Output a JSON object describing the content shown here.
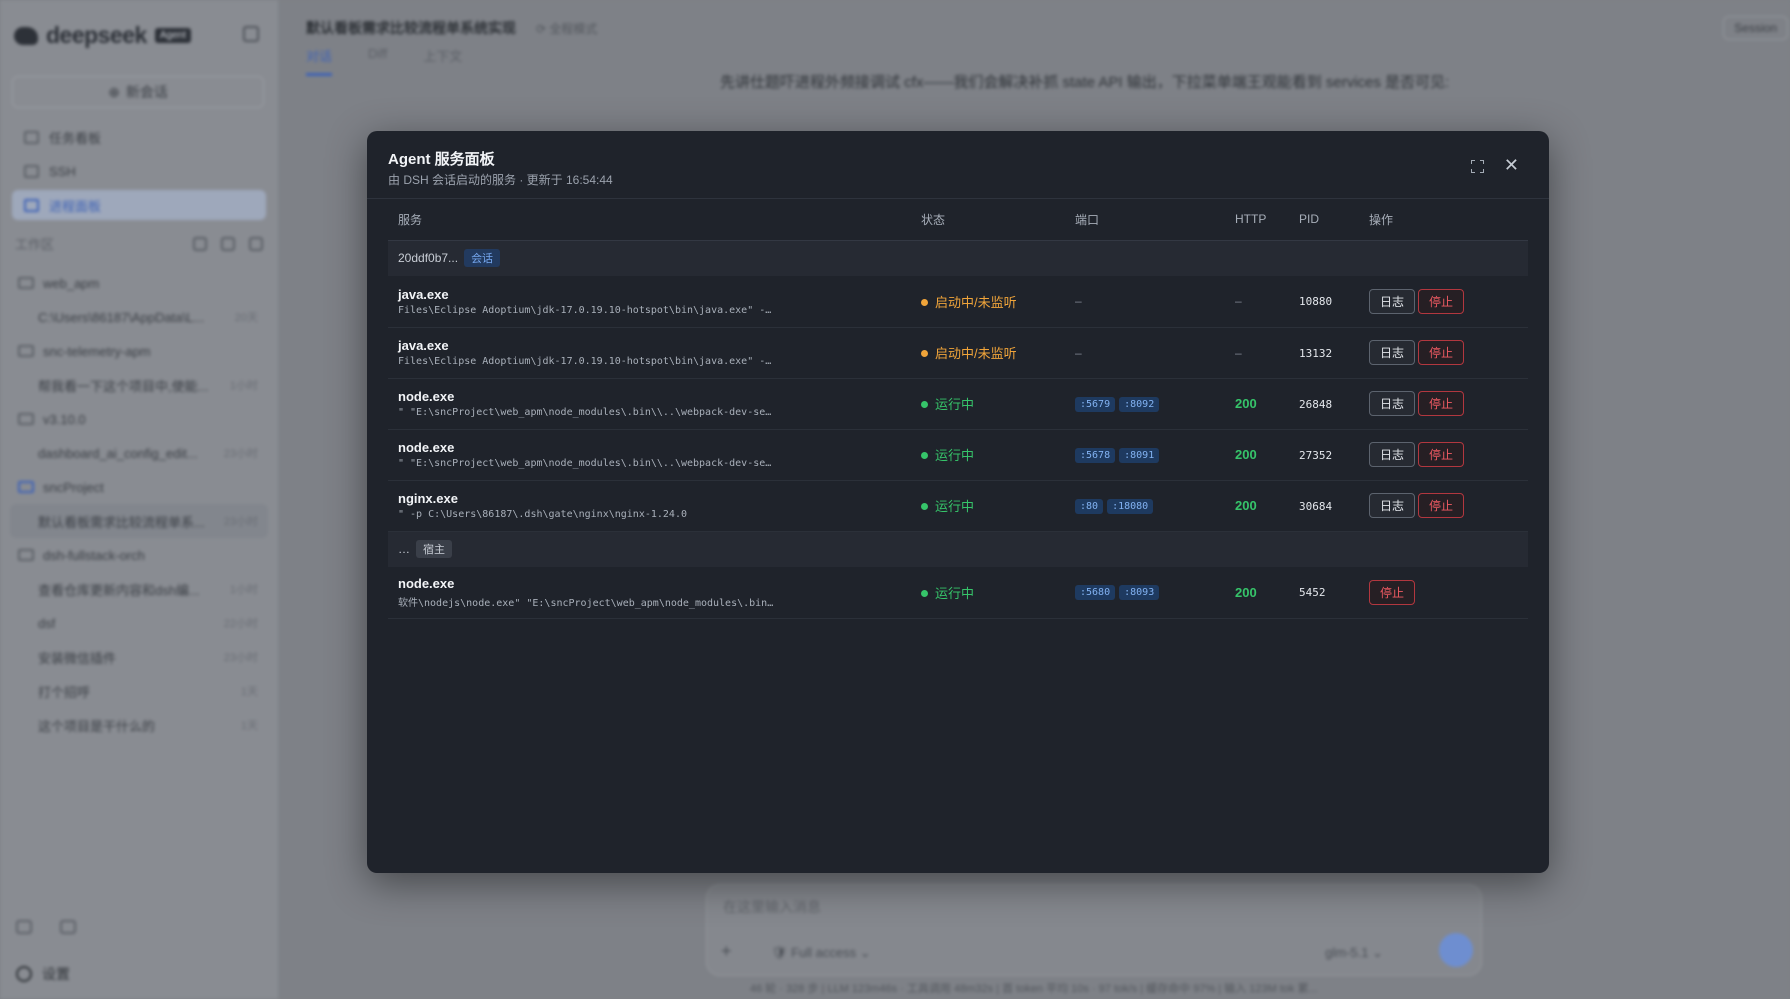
{
  "app": {
    "brand": "deepseek",
    "brand_badge": "Agent",
    "new_chat": "新会话",
    "nav": [
      "任务看板",
      "SSH",
      "进程面板"
    ],
    "workspace_label": "工作区",
    "tree": [
      {
        "type": "folder",
        "label": "web_apm"
      },
      {
        "type": "child",
        "label": "C:\\Users\\86187\\AppData\\L...",
        "date": "20天"
      },
      {
        "type": "folder",
        "label": "snc-telemetry-apm"
      },
      {
        "type": "child",
        "label": "帮我看一下这个项目中,使能...",
        "date": "1小时"
      },
      {
        "type": "folder",
        "label": "v3.10.0"
      },
      {
        "type": "child",
        "label": "dashboard_ai_config_edit...",
        "date": "23小时"
      },
      {
        "type": "folder",
        "label": "sncProject",
        "blue": true
      },
      {
        "type": "child",
        "label": "默认看板需求比较流程单系...",
        "date": "23小时",
        "selected": true
      },
      {
        "type": "folder",
        "label": "dsh-fullstack-orch"
      },
      {
        "type": "child",
        "label": "查看仓库更新内容和dsh编...",
        "date": "1小时"
      },
      {
        "type": "child",
        "label": "dsf",
        "date": "22小时"
      },
      {
        "type": "child",
        "label": "安装微信插件",
        "date": "23小时"
      },
      {
        "type": "child",
        "label": "打个招呼",
        "date": "1天"
      },
      {
        "type": "child",
        "label": "这个项目是干什么的",
        "date": "1天"
      }
    ],
    "settings": "设置",
    "chat_title": "默认看板需求比较流程单系统实现",
    "chat_mode": "全程模式",
    "tabs": [
      "对话",
      "Diff",
      "上下文"
    ],
    "session_btn": "Session",
    "message": "先讲仕题吓进程外频接调试 cfx——我们会解决补抓 state API 输出，下拉菜单端王观能看到 services 是否可见:",
    "composer_placeholder": "在这里输入消息",
    "composer_access": "Full access",
    "composer_model": "glm-5.1",
    "status_line": "46 轮 · 328 步 | LLM 123m46s · 工具调用 48m32s | 首 token 平均 10s · 97 tok/s | 缓存命中 97% | 输入 123M tok 累..."
  },
  "modal": {
    "title": "Agent 服务面板",
    "subtitle": "由 DSH 会话启动的服务 · 更新于 16:54:44",
    "headers": [
      "服务",
      "状态",
      "端口",
      "HTTP",
      "PID",
      "操作"
    ],
    "log_label": "日志",
    "stop_label": "停止",
    "groups": [
      {
        "id": "20ddf0b7...",
        "tag": "会话",
        "tag_kind": "sess",
        "services": [
          {
            "name": "java.exe",
            "cmd": "Files\\Eclipse Adoptium\\jdk-17.0.19.10-hotspot\\bin\\java.exe\" -…",
            "status": "启动中/未监听",
            "status_color": "#f0a43a",
            "ports": [],
            "port_text": "–",
            "http": "–",
            "pid": "10880",
            "log": true
          },
          {
            "name": "java.exe",
            "cmd": "Files\\Eclipse Adoptium\\jdk-17.0.19.10-hotspot\\bin\\java.exe\" -…",
            "status": "启动中/未监听",
            "status_color": "#f0a43a",
            "ports": [],
            "port_text": "–",
            "http": "–",
            "pid": "13132",
            "log": true
          },
          {
            "name": "node.exe",
            "cmd": "\" \"E:\\sncProject\\web_apm\\node_modules\\.bin\\\\..\\webpack-dev-se…",
            "status": "运行中",
            "status_color": "#36c46a",
            "ports": [
              ":5679",
              ":8092"
            ],
            "port_text": "",
            "http": "200",
            "pid": "26848",
            "log": true
          },
          {
            "name": "node.exe",
            "cmd": "\" \"E:\\sncProject\\web_apm\\node_modules\\.bin\\\\..\\webpack-dev-se…",
            "status": "运行中",
            "status_color": "#36c46a",
            "ports": [
              ":5678",
              ":8091"
            ],
            "port_text": "",
            "http": "200",
            "pid": "27352",
            "log": true
          },
          {
            "name": "nginx.exe",
            "cmd": "\" -p C:\\Users\\86187\\.dsh\\gate\\nginx\\nginx-1.24.0",
            "status": "运行中",
            "status_color": "#36c46a",
            "ports": [
              ":80",
              ":18080"
            ],
            "port_text": "",
            "http": "200",
            "pid": "30684",
            "log": true
          }
        ]
      },
      {
        "id": "…",
        "tag": "宿主",
        "tag_kind": "host",
        "services": [
          {
            "name": "node.exe",
            "cmd": "软件\\nodejs\\node.exe\" \"E:\\sncProject\\web_apm\\node_modules\\.bin…",
            "status": "运行中",
            "status_color": "#36c46a",
            "ports": [
              ":5680",
              ":8093"
            ],
            "port_text": "",
            "http": "200",
            "pid": "5452",
            "log": false
          }
        ]
      }
    ]
  }
}
